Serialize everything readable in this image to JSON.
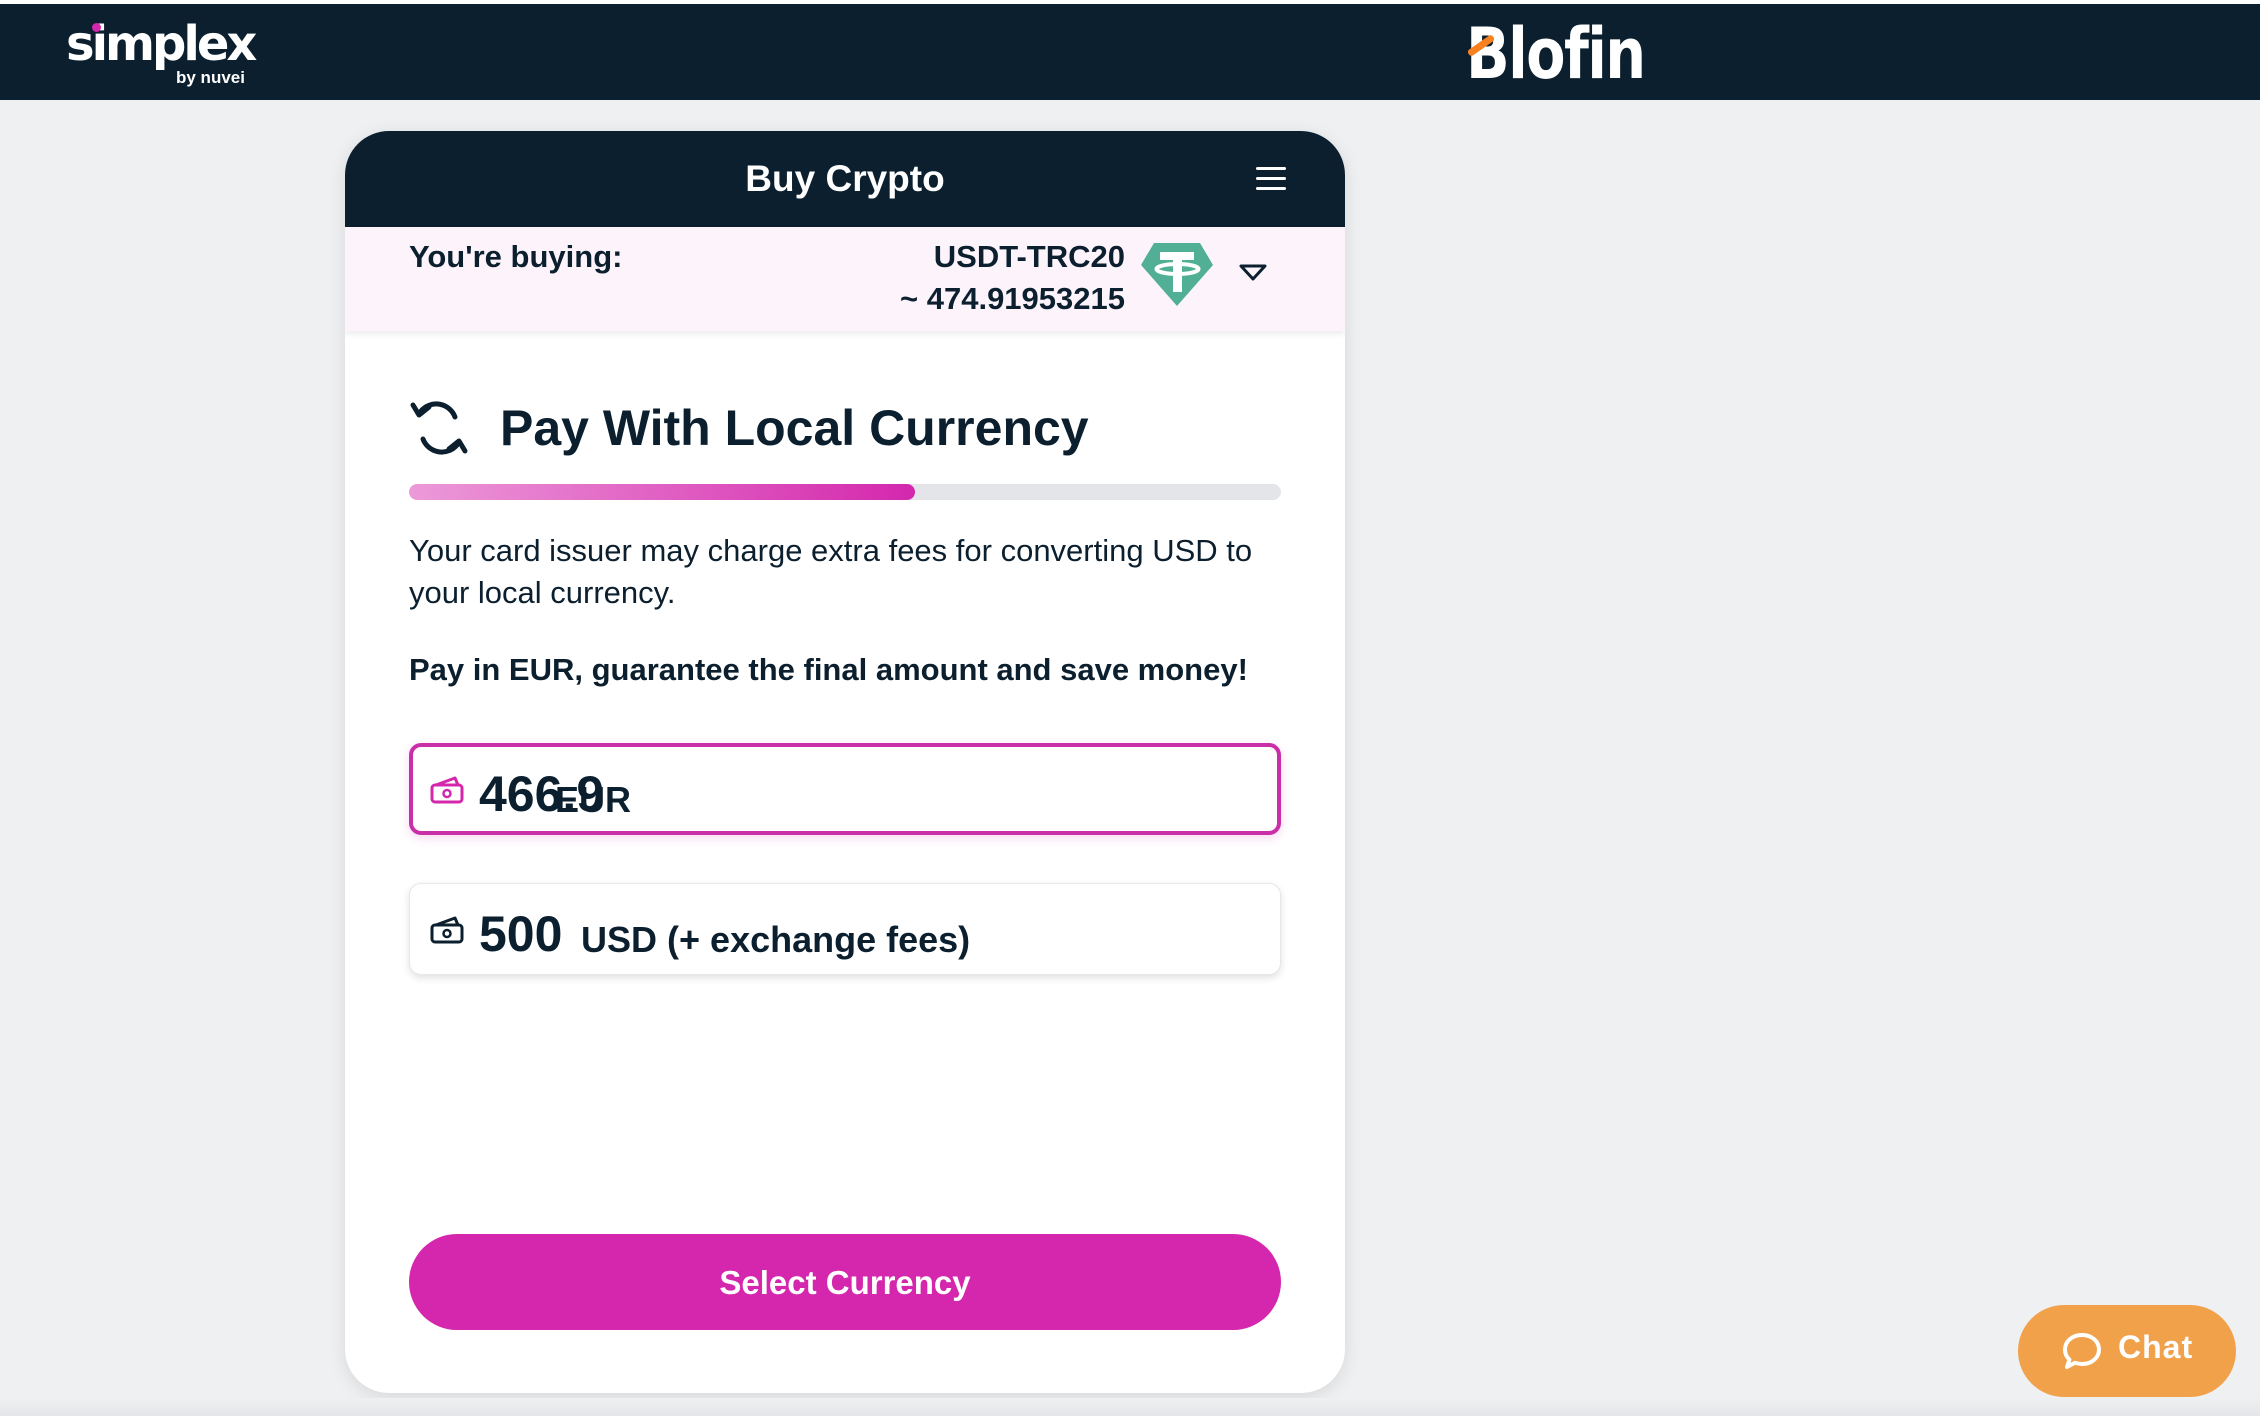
{
  "header": {
    "simplex_logo": "simplex",
    "simplex_byline": "by nuvei",
    "partner_logo": "Blofin"
  },
  "widget": {
    "title": "Buy Crypto",
    "buying_label": "You're buying:",
    "coin_name": "USDT-TRC20",
    "coin_amount": "~ 474.91953215",
    "section_title": "Pay With Local Currency",
    "progress_percent": 58,
    "info_text": "Your card issuer may charge extra fees for converting USD to your local currency.",
    "promo_text": "Pay in EUR, guarantee the final amount and save money!",
    "options": [
      {
        "amount": "466.9",
        "unit": "EUR",
        "selected": true
      },
      {
        "amount": "500",
        "unit": "USD",
        "note": "(+ exchange fees)",
        "selected": false
      }
    ],
    "select_button": "Select Currency"
  },
  "chat": {
    "label": "Chat"
  },
  "colors": {
    "navy": "#0b1f2e",
    "magenta": "#d427ad",
    "tether_green": "#50af95",
    "chat_orange": "#f2a14b",
    "page_bg": "#eff0f2"
  },
  "icons": {
    "menu": "hamburger-menu-icon",
    "coin": "tether-icon",
    "dropdown": "chevron-down-icon",
    "section": "currency-exchange-icon",
    "cash": "cash-icon",
    "chat": "chat-bubble-icon"
  }
}
